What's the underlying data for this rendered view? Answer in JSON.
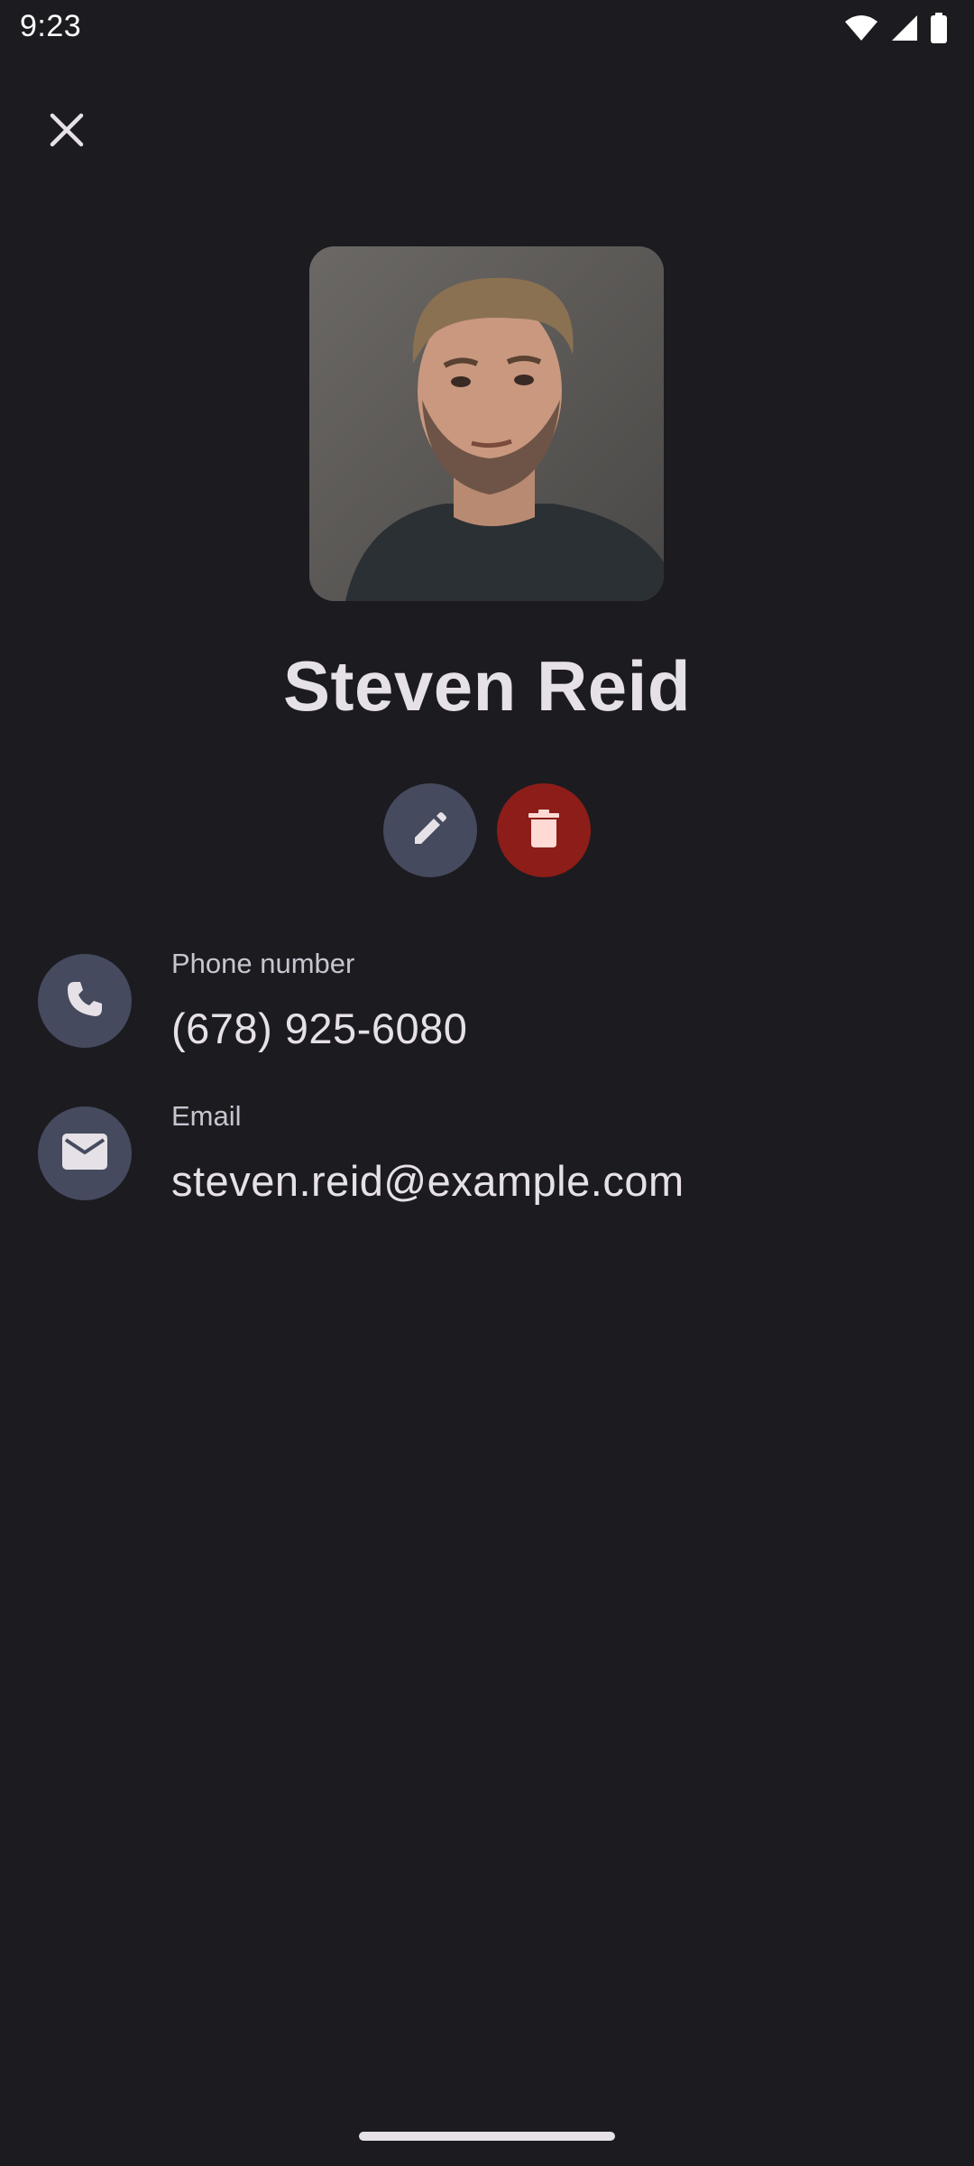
{
  "status_bar": {
    "time": "9:23",
    "icons": [
      "wifi-icon",
      "cellular-signal-icon",
      "battery-icon"
    ]
  },
  "toolbar": {
    "close_icon": "close-icon"
  },
  "contact": {
    "name": "Steven Reid",
    "photo_icon": "contact-photo"
  },
  "actions": {
    "edit_icon": "pencil-icon",
    "delete_icon": "trash-icon"
  },
  "details": {
    "phone": {
      "label": "Phone number",
      "value": "(678) 925-6080",
      "icon": "phone-icon"
    },
    "email": {
      "label": "Email",
      "value": "steven.reid@example.com",
      "icon": "mail-icon"
    }
  },
  "colors": {
    "background": "#1c1b20",
    "icon_circle": "#454a5e",
    "delete_button": "#8c1d18",
    "text_primary": "#e6e1e6",
    "text_secondary": "#c8c5d0"
  }
}
